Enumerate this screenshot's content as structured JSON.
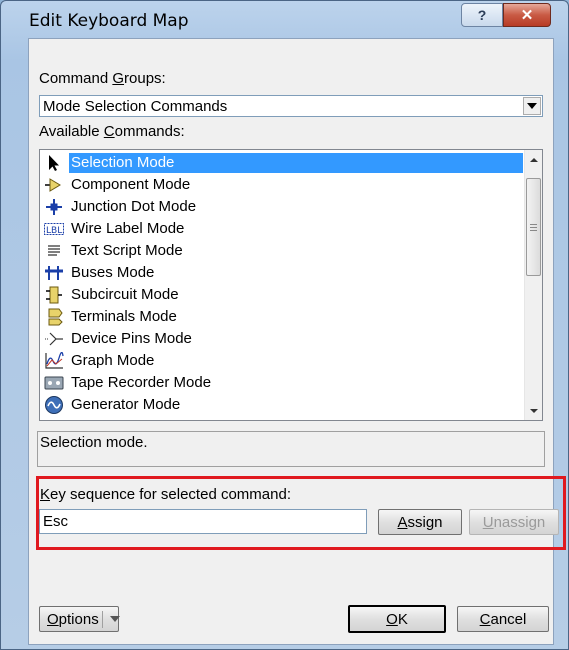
{
  "window": {
    "title": "Edit Keyboard Map",
    "help_glyph": "?",
    "close_glyph": "✕"
  },
  "command_groups": {
    "label_pre": "Command ",
    "label_u": "G",
    "label_post": "roups:",
    "selected": "Mode Selection Commands"
  },
  "available_commands": {
    "label_pre": "Available ",
    "label_u": "C",
    "label_post": "ommands:",
    "items": [
      {
        "label": "Selection Mode",
        "icon": "arrow-pointer-icon",
        "selected": true
      },
      {
        "label": "Component Mode",
        "icon": "component-arrow-icon",
        "selected": false
      },
      {
        "label": "Junction Dot Mode",
        "icon": "junction-dot-icon",
        "selected": false
      },
      {
        "label": "Wire Label Mode",
        "icon": "wire-label-icon",
        "selected": false
      },
      {
        "label": "Text Script Mode",
        "icon": "text-script-icon",
        "selected": false
      },
      {
        "label": "Buses Mode",
        "icon": "bus-icon",
        "selected": false
      },
      {
        "label": "Subcircuit Mode",
        "icon": "subcircuit-icon",
        "selected": false
      },
      {
        "label": "Terminals Mode",
        "icon": "terminal-icon",
        "selected": false
      },
      {
        "label": "Device Pins Mode",
        "icon": "device-pin-icon",
        "selected": false
      },
      {
        "label": "Graph Mode",
        "icon": "graph-icon",
        "selected": false
      },
      {
        "label": "Tape Recorder Mode",
        "icon": "tape-recorder-icon",
        "selected": false
      },
      {
        "label": "Generator Mode",
        "icon": "generator-icon",
        "selected": false
      }
    ]
  },
  "description": "Selection mode.",
  "key_sequence": {
    "label_u": "K",
    "label_post": "ey sequence for selected command:",
    "value": "Esc",
    "assign_u": "A",
    "assign_post": "ssign",
    "unassign_u": "U",
    "unassign_post": "nassign"
  },
  "footer": {
    "options_pre": "O",
    "options_post": "ptions",
    "ok_u": "O",
    "ok_post": "K",
    "cancel_u": "C",
    "cancel_post": "ancel"
  },
  "colors": {
    "highlight": "#3399ff",
    "red_frame": "#e0191f"
  }
}
